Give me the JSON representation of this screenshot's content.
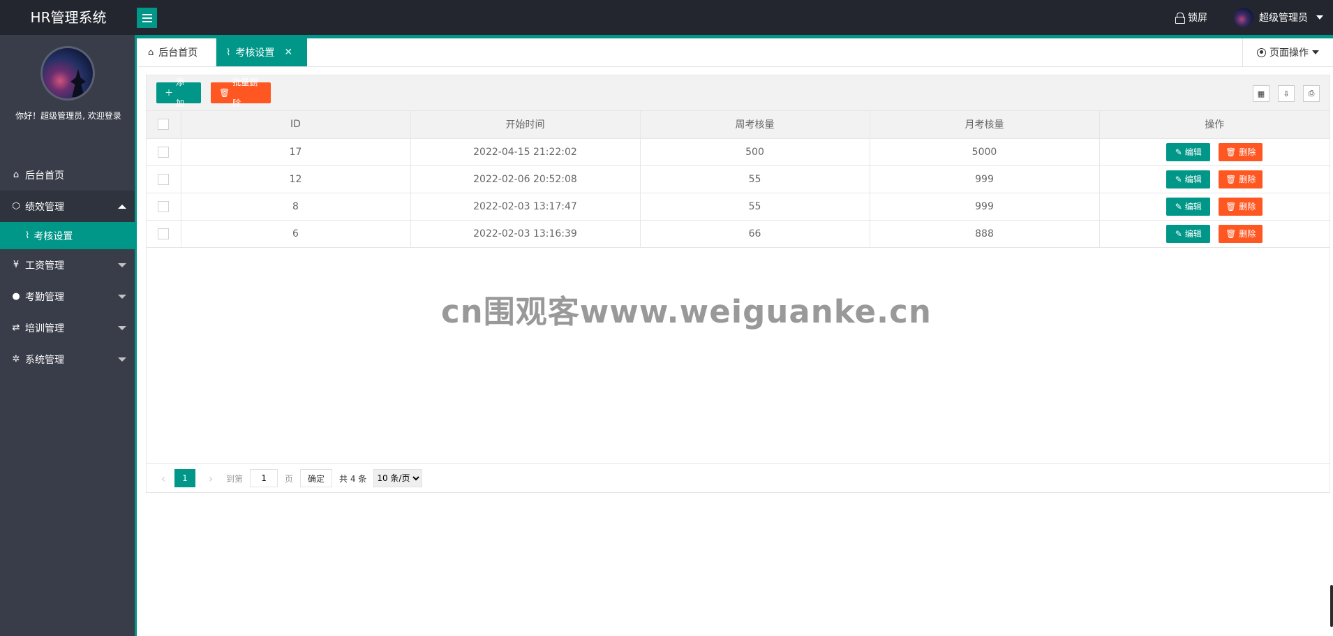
{
  "header": {
    "logo": "HR管理系统",
    "lock_label": "锁屏",
    "user_name": "超级管理员"
  },
  "sidebar": {
    "welcome": "你好！超级管理员, 欢迎登录",
    "items": [
      {
        "label": "后台首页",
        "icon": "home-icon"
      },
      {
        "label": "绩效管理",
        "icon": "cube-icon",
        "open": true,
        "children": [
          {
            "label": "考核设置",
            "icon": "activity-icon"
          }
        ]
      },
      {
        "label": "工资管理",
        "icon": "yen-icon"
      },
      {
        "label": "考勤管理",
        "icon": "chat-icon"
      },
      {
        "label": "培训管理",
        "icon": "exchange-icon"
      },
      {
        "label": "系统管理",
        "icon": "gear-icon"
      }
    ]
  },
  "tabs": {
    "home": "后台首页",
    "active": "考核设置",
    "page_ops": "页面操作"
  },
  "toolbar": {
    "add": "添加",
    "batch_delete": "批量删除"
  },
  "table": {
    "headers": [
      "ID",
      "开始时间",
      "周考核量",
      "月考核量",
      "操作"
    ],
    "rows": [
      [
        "17",
        "2022-04-15 21:22:02",
        "500",
        "5000"
      ],
      [
        "12",
        "2022-02-06 20:52:08",
        "55",
        "999"
      ],
      [
        "8",
        "2022-02-03 13:17:47",
        "55",
        "999"
      ],
      [
        "6",
        "2022-02-03 13:16:39",
        "66",
        "888"
      ]
    ],
    "edit_label": "编辑",
    "delete_label": "删除"
  },
  "pager": {
    "current": "1",
    "goto_label": "到第",
    "goto_value": "1",
    "page_label": "页",
    "confirm": "确定",
    "total": "共 4 条",
    "page_size": "10 条/页"
  },
  "watermark": "cn围观客www.weiguanke.cn",
  "colors": {
    "accent": "#009688",
    "danger": "#ff5722",
    "sidebar": "#393d49",
    "header": "#23262e"
  }
}
